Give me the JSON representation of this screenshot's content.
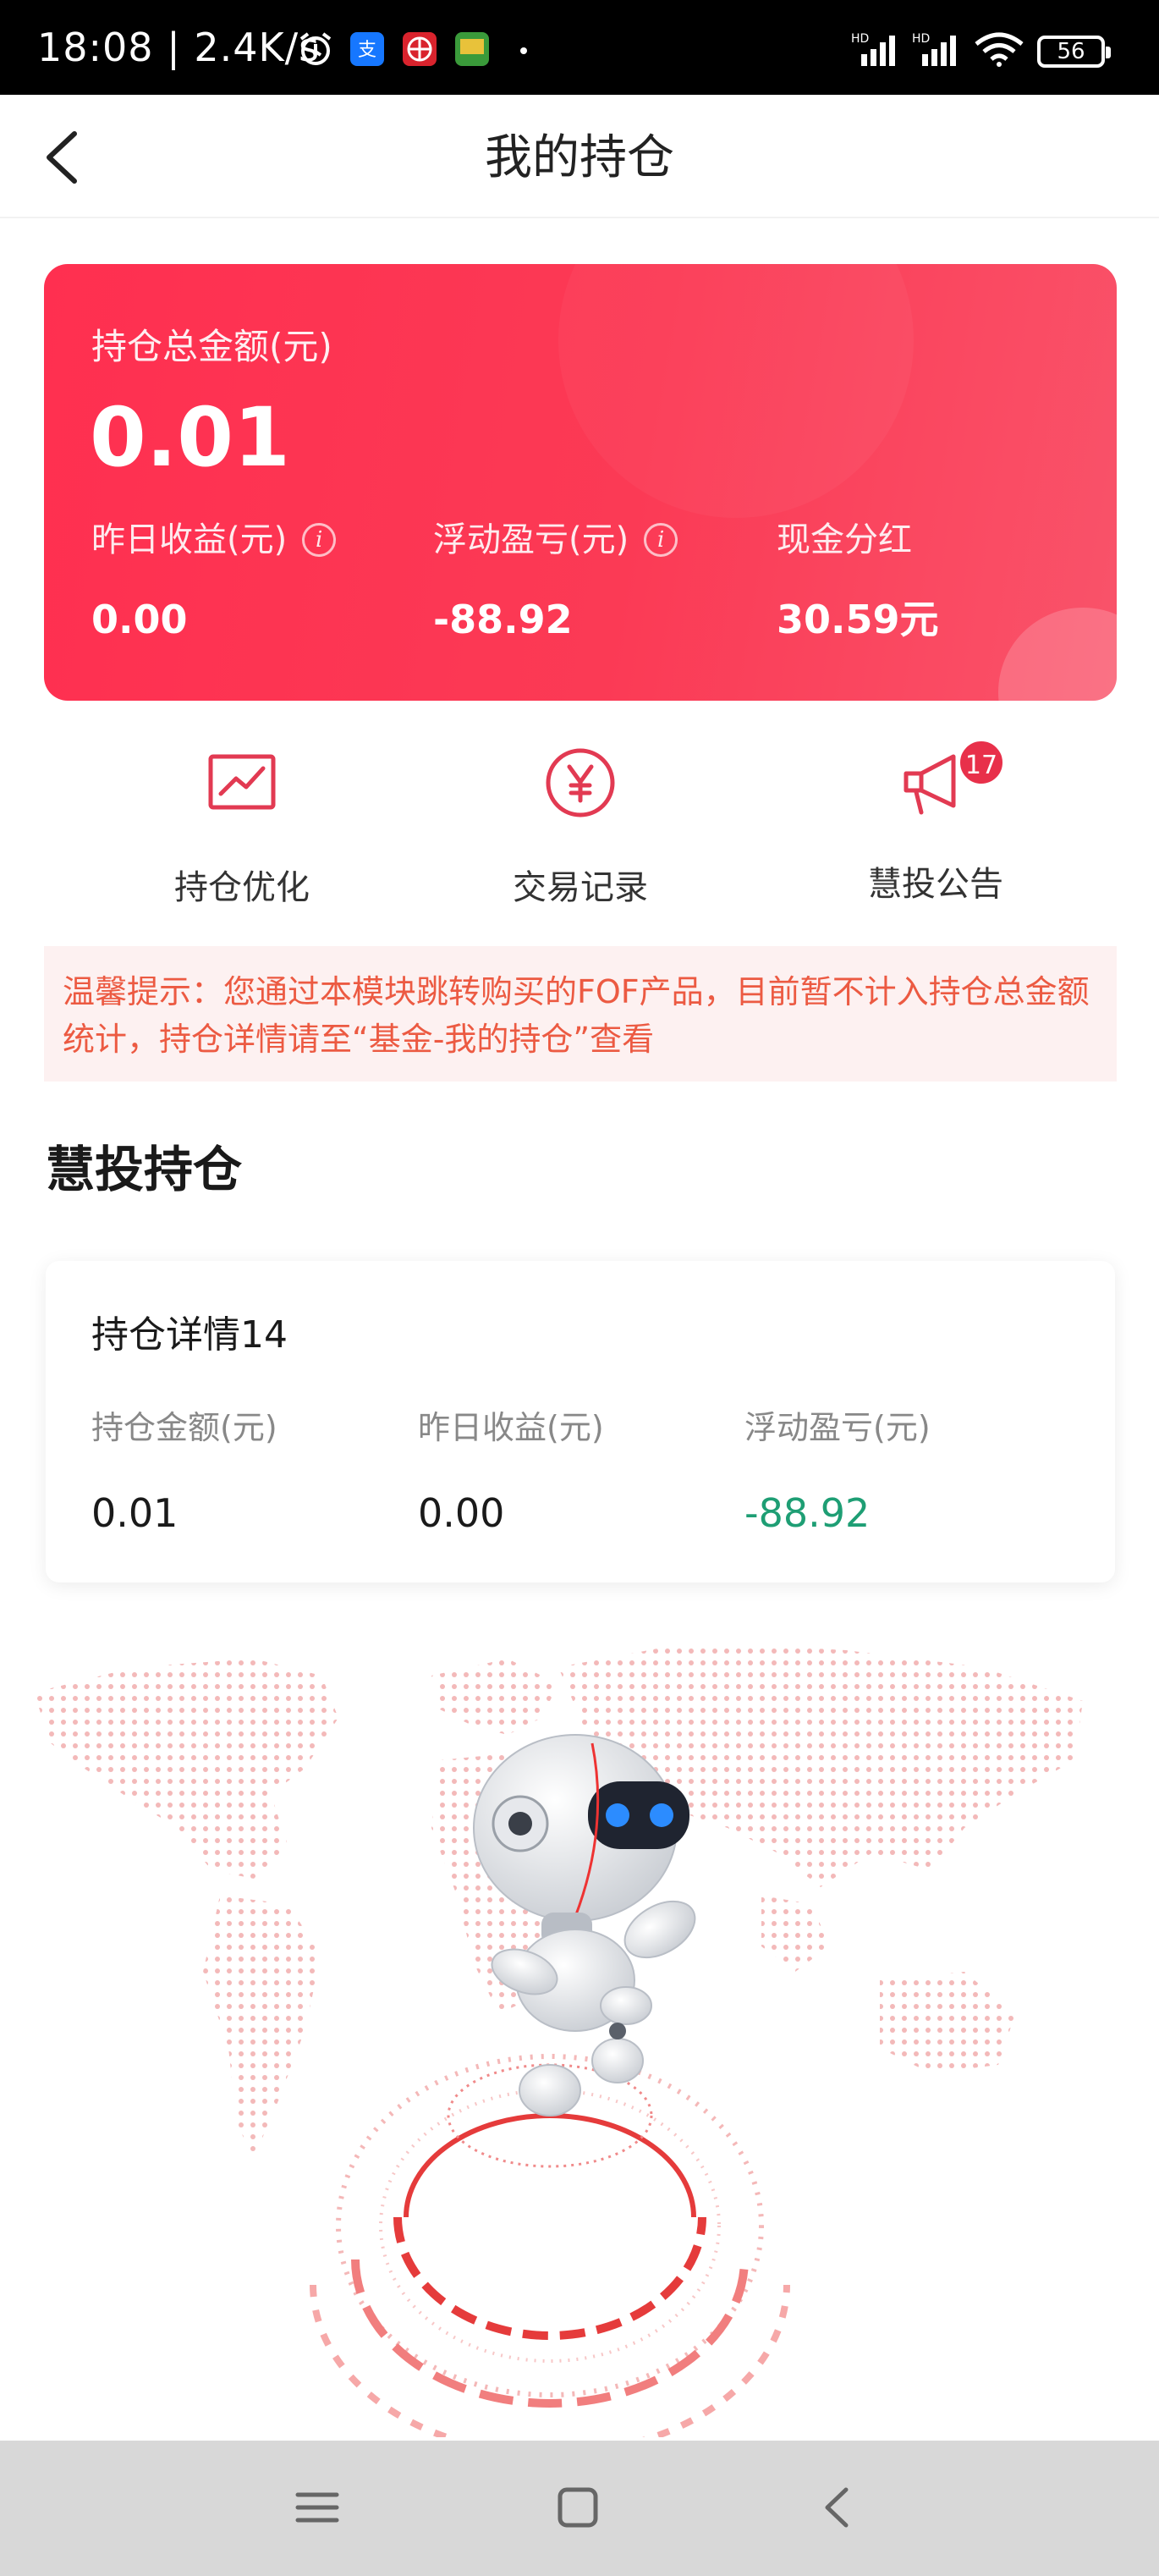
{
  "status_bar": {
    "time": "18:08",
    "speed": "2.4K/s",
    "signal1_label": "HD",
    "signal2_label": "HD",
    "battery": "56"
  },
  "nav": {
    "title": "我的持仓",
    "back_icon": "chevron-left-icon"
  },
  "summary": {
    "total_label": "持仓总金额(元)",
    "total_value": "0.01",
    "yesterday_label": "昨日收益(元)",
    "yesterday_value": "0.00",
    "floating_label": "浮动盈亏(元)",
    "floating_value": "-88.92",
    "dividend_label": "现金分红",
    "dividend_value": "30.59元"
  },
  "actions": [
    {
      "label": "持仓优化",
      "icon": "trend-chart-icon"
    },
    {
      "label": "交易记录",
      "icon": "yen-circle-icon"
    },
    {
      "label": "慧投公告",
      "icon": "megaphone-icon",
      "badge": "17"
    }
  ],
  "tip": {
    "text": "温馨提示：您通过本模块跳转购买的FOF产品，目前暂不计入持仓总金额统计，持仓详情请至“基金-我的持仓”查看"
  },
  "section": {
    "title": "慧投持仓"
  },
  "holding": {
    "name": "持仓详情14",
    "amount_label": "持仓金额(元)",
    "amount_value": "0.01",
    "yesterday_label": "昨日收益(元)",
    "yesterday_value": "0.00",
    "floating_label": "浮动盈亏(元)",
    "floating_value": "-88.92"
  },
  "colors": {
    "brand_red": "#fb3a55",
    "tip_text": "#ec5a42",
    "gain_green": "#1e9e74"
  },
  "system_nav": {
    "menu_icon": "menu-icon",
    "home_icon": "home-square-icon",
    "back_icon": "back-triangle-icon"
  }
}
